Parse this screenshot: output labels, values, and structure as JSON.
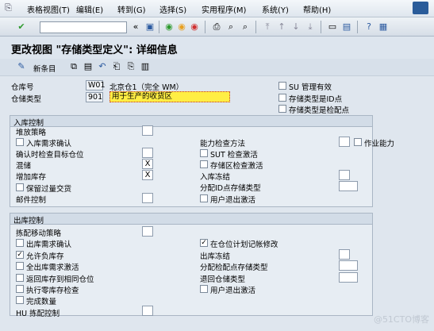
{
  "menu": [
    "表格视图(T)",
    "编辑(E)",
    "转到(G)",
    "选择(S)",
    "实用程序(M)",
    "系统(Y)",
    "帮助(H)"
  ],
  "title": "更改视图 \"存储类型定义\": 详细信息",
  "app_toolbar": {
    "new_entries": "新条目"
  },
  "header": {
    "warehouse_label": "仓库号",
    "warehouse_value": "W01",
    "warehouse_desc": "北京仓1（完全 WM）",
    "stortype_label": "仓储类型",
    "stortype_value": "901",
    "stortype_desc": "用于生产的收货区",
    "su_mgmt": "SU 管理有效",
    "is_id_point": "存储类型是ID点",
    "is_pick_point": "存储类型是检配点"
  },
  "inbound": {
    "title": "入库控制",
    "putaway_strategy": "堆放策略",
    "confirm_req": "入库需求确认",
    "check_dest_bin": "确认时检查目标仓位",
    "mixed": "混储",
    "mixed_value": "X",
    "add_stock": "增加库存",
    "add_stock_value": "X",
    "keep_overdelivery": "保留过量交货",
    "mail_control": "邮件控制",
    "capacity_check": "能力检查方法",
    "work_capacity": "作业能力",
    "sut_check": "SUT 检查激活",
    "bin_check": "存储区检查激活",
    "inbound_freeze": "入库冻结",
    "assign_id_point": "分配ID点存储类型",
    "user_exit": "用户退出激活"
  },
  "outbound": {
    "title": "出库控制",
    "removal_strategy": "拣配移动策略",
    "confirm_req": "出库需求确认",
    "allow_neg": "允许负库存",
    "full_stock": "全出库需求激活",
    "return_same_bin": "返回库存到相同仓位",
    "zero_check": "执行零库存检查",
    "round_qty": "完成数量",
    "hu_pick": "HU 拣配控制",
    "bin_posting": "在仓位计划记帐修改",
    "outbound_freeze": "出库冻结",
    "assign_pick_point": "分配检配点存储类型",
    "return_stortype": "退回仓储类型",
    "user_exit": "用户退出激活"
  },
  "watermark": "@51CTO博客"
}
